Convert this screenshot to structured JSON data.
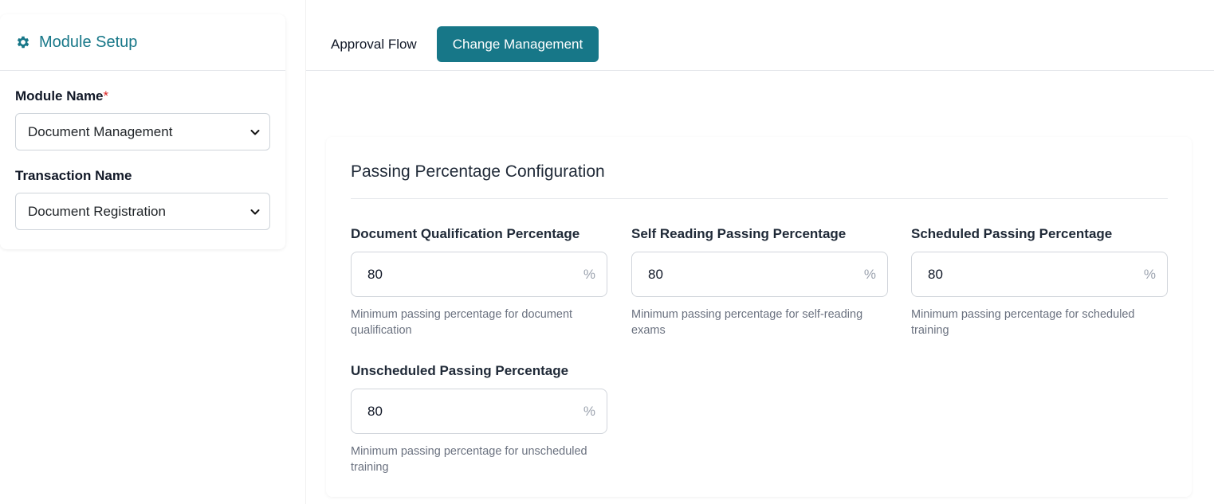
{
  "sidebar": {
    "title": "Module Setup",
    "module_name_label": "Module Name",
    "required_mark": "*",
    "module_name_value": "Document Management",
    "transaction_name_label": "Transaction Name",
    "transaction_name_value": "Document Registration"
  },
  "tabs": [
    {
      "label": "Approval Flow",
      "active": false
    },
    {
      "label": "Change Management",
      "active": true
    }
  ],
  "config": {
    "title": "Passing Percentage Configuration",
    "fields": [
      {
        "label": "Document Qualification Percentage",
        "value": "80",
        "suffix": "%",
        "help": "Minimum passing percentage for document qualification"
      },
      {
        "label": "Self Reading Passing Percentage",
        "value": "80",
        "suffix": "%",
        "help": "Minimum passing percentage for self-reading exams"
      },
      {
        "label": "Scheduled Passing Percentage",
        "value": "80",
        "suffix": "%",
        "help": "Minimum passing percentage for scheduled training"
      },
      {
        "label": "Unscheduled Passing Percentage",
        "value": "80",
        "suffix": "%",
        "help": "Minimum passing percentage for unscheduled training"
      }
    ]
  },
  "colors": {
    "accent": "#177788",
    "required": "#dc2626"
  },
  "icons": {
    "header": "gear-icon",
    "select": "chevron-down-icon"
  }
}
